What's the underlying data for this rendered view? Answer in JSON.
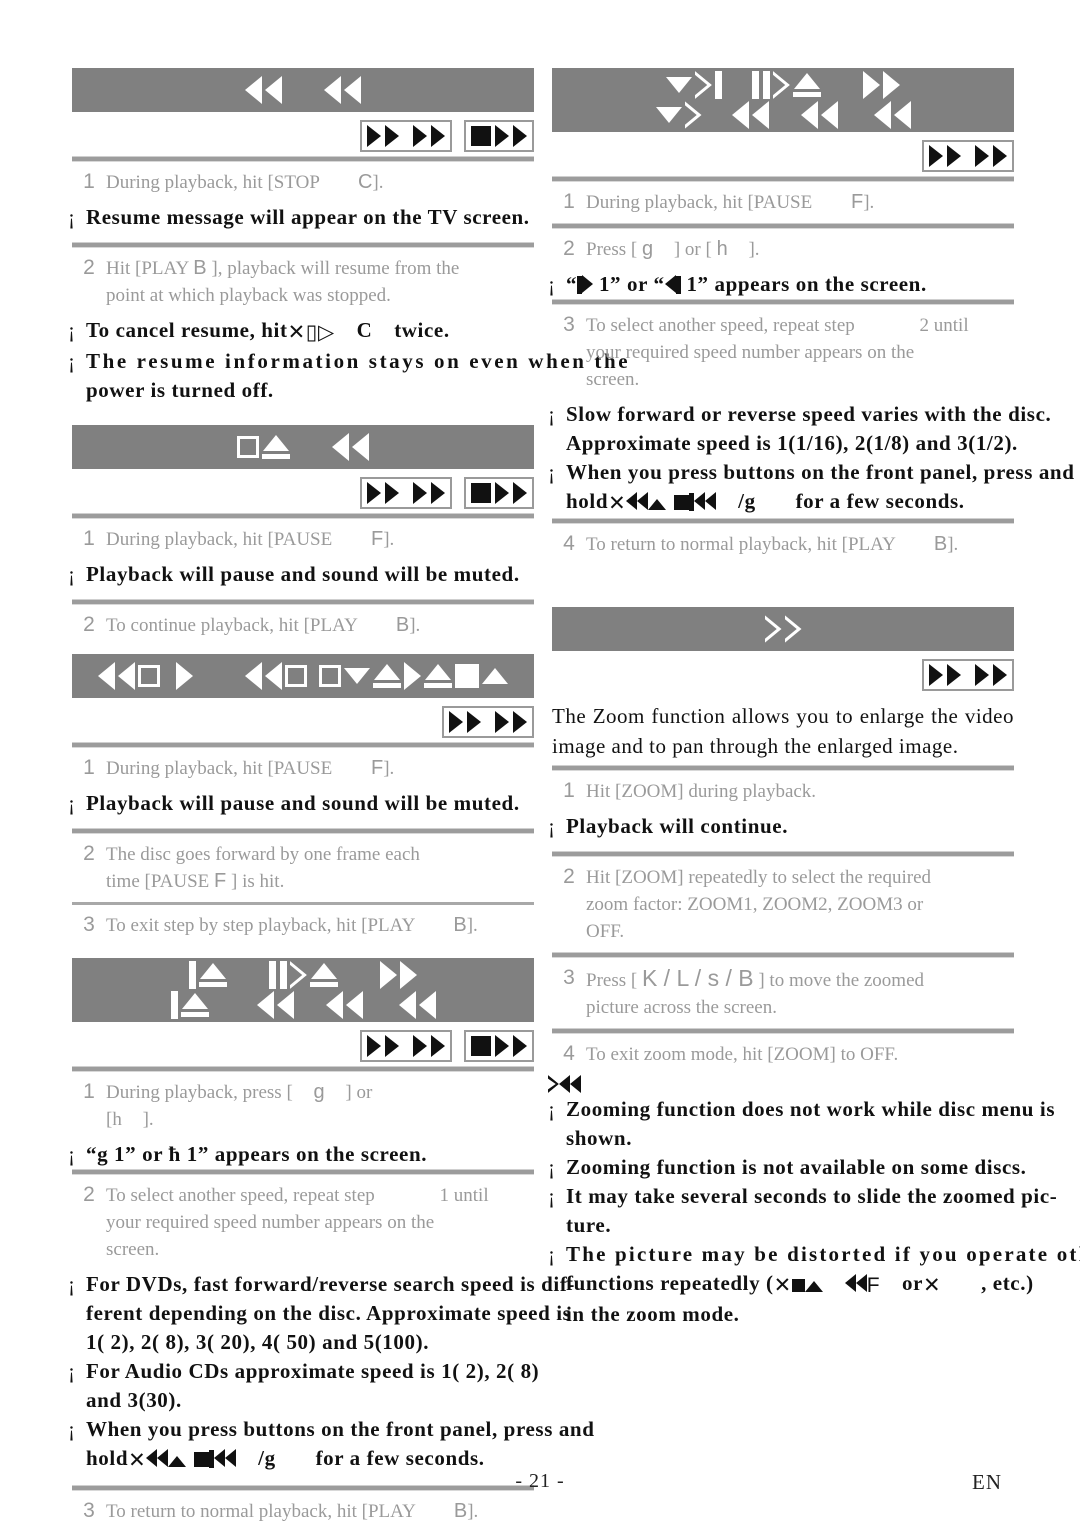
{
  "document": {
    "footer": {
      "page_number": "- 21 -",
      "language": "EN"
    }
  },
  "left_column": {
    "sections": [
      {
        "id": "resume",
        "header_glyphs": "rewind rewind",
        "badges": [
          "dvd-video-badge",
          "video-cd-badge"
        ],
        "steps": [
          {
            "num": "1",
            "text_a": "During playback, hit [STOP",
            "sym": "C",
            "text_b": "]."
          },
          {
            "num": "2",
            "text_a": "Hit [PLAY",
            "sym": "B",
            "text_b": "], playback will resume from the",
            "line2": "point at which playback was stopped."
          }
        ],
        "notes": [
          "Resume message will appear on the TV screen.",
          "To cancel resume, hit",
          "C",
          "twice.",
          "The resume information stays on even when the",
          "power is turned off."
        ]
      },
      {
        "id": "pause",
        "header_glyphs": "eject rewind",
        "badges": [
          "dvd-video-badge",
          "video-cd-badge"
        ],
        "steps": [
          {
            "num": "1",
            "text_a": "During playback, hit [PAUSE",
            "sym": "F",
            "text_b": "]."
          },
          {
            "num": "2",
            "text_a": "To continue playback, hit [PLAY",
            "sym": "B",
            "text_b": "]."
          }
        ],
        "notes": [
          "Playback will pause and sound will be muted."
        ]
      },
      {
        "id": "step-by-step",
        "header_glyphs": "rewind-square-play rewind-square-square-down-up-play-up-square-up",
        "badges": [
          "dvd-video-badge"
        ],
        "steps": [
          {
            "num": "1",
            "text_a": "During playback, hit [PAUSE",
            "sym": "F",
            "text_b": "]."
          },
          {
            "num": "2",
            "text_a": "The disc goes forward by one frame each",
            "line2a": "time [PAUSE",
            "sym2": "F",
            "line2b": "] is hit."
          },
          {
            "num": "3",
            "text_a": "To exit step by step playback, hit [PLAY",
            "sym": "B",
            "text_b": "]."
          }
        ],
        "notes": [
          "Playback will pause and sound will be muted."
        ]
      },
      {
        "id": "fast-forward-reverse",
        "header_glyphs": "pause-eject pause-play-eject forward / pause-eject rewind rewind rewind",
        "badges": [
          "dvd-video-badge",
          "video-cd-badge"
        ],
        "steps": [
          {
            "num": "1",
            "text_a": "During playback, press [",
            "sym": "g",
            "text_b": "] or",
            "line2": "[h",
            "line2b": "]."
          },
          {
            "num": "2",
            "text_a": "To select another speed, repeat step",
            "sym": "1",
            "text_b": "until",
            "line2": "your required speed number appears on the",
            "line3": "screen."
          },
          {
            "num": "3",
            "text_a": "To return to normal playback, hit [PLAY",
            "sym": "B",
            "text_b": "]."
          }
        ],
        "notes": [
          "“g       1” or ħ      1” appears on the screen.",
          "For DVDs, fast forward/reverse search speed is dif-",
          "ferent depending on the disc. Approximate speed is",
          "1( 2), 2( 8), 3( 20), 4( 50) and 5(100).",
          "For Audio CDs approximate speed is 1( 2), 2( 8)",
          "and 3(30).",
          "When you press buttons on the front panel, press and",
          "hold",
          "/g",
          "for a few seconds."
        ]
      }
    ]
  },
  "right_column": {
    "sections": [
      {
        "id": "slow-forward-reverse",
        "header_glyphs": "down-play-bar pause-play-eject forward / down-play rewind rewind rewind",
        "badges": [
          "dvd-video-badge"
        ],
        "steps": [
          {
            "num": "1",
            "text_a": "During playback, hit [PAUSE",
            "sym": "F",
            "text_b": "]."
          },
          {
            "num": "2",
            "text_a": "Press [",
            "sym": "g",
            "text_b": "] or [",
            "sym2": "h",
            "text_c": "]."
          },
          {
            "num": "3",
            "text_a": "To select another speed, repeat step",
            "sym": "2",
            "text_b": "until",
            "line2": "your required speed number appears on the",
            "line3": "screen."
          },
          {
            "num": "4",
            "text_a": "To return to normal playback, hit [PLAY",
            "sym": "B",
            "text_b": "]."
          }
        ],
        "notes": [
          "“  1” or “  1” appears on the screen.",
          "Slow forward or reverse speed varies with the disc.",
          "Approximate speed is 1(1/16), 2(1/8) and 3(1/2).",
          "When you press buttons on the front panel, press and",
          "hold",
          "/g",
          "for a few seconds."
        ]
      },
      {
        "id": "zoom",
        "header_glyphs": "play-outline",
        "badges": [
          "dvd-video-badge"
        ],
        "intro": "The Zoom function allows you to enlarge the video image and to pan through the enlarged image.",
        "steps": [
          {
            "num": "1",
            "text_a": "Hit [ZOOM] during playback."
          },
          {
            "num": "2",
            "text_a": "Hit [ZOOM] repeatedly to select the required",
            "line2": "zoom factor: ZOOM1, ZOOM2, ZOOM3 or",
            "line3": "OFF."
          },
          {
            "num": "3",
            "text_a": "Press [",
            "sym": "K / L / s / B",
            "text_b": "] to move the zoomed",
            "line2": "picture across the screen."
          },
          {
            "num": "4",
            "text_a": "To exit zoom mode, hit [ZOOM] to OFF."
          }
        ],
        "notes": [
          "Playback will continue.",
          "Zooming function does not work while disc menu is",
          "shown.",
          "Zooming function is not available on some discs.",
          "It may take several seconds to slide the zoomed pic-",
          "ture.",
          "The picture may be distorted if you operate other",
          "functions repeatedly (",
          "or",
          ", etc.)",
          "in the zoom mode."
        ]
      }
    ]
  },
  "colors": {
    "header_bar": "#808080",
    "step_text": "#9a9a9a",
    "note_text": "#111111",
    "separator": "#9c9c9c"
  }
}
